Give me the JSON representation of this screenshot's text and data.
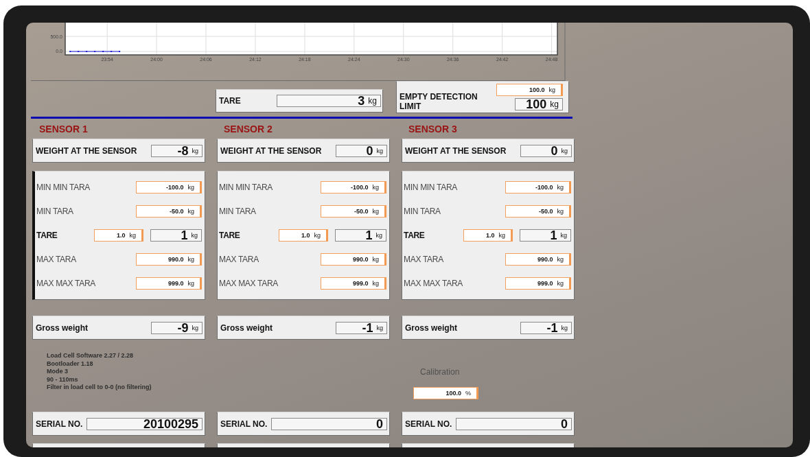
{
  "chart": {
    "chart_data": {
      "type": "line",
      "grid": true,
      "x": [
        1429.5,
        1430.5,
        1431.5,
        1432.5,
        1433.5,
        1434.5,
        1435.5
      ],
      "series": [
        {
          "color": "#1a1ad8",
          "line_style": "solid",
          "marker": "square",
          "values": [
            0,
            0,
            0,
            0,
            0,
            0,
            0
          ]
        }
      ],
      "xlim": [
        1428.9,
        1488.7
      ],
      "ylim": [
        -114,
        955
      ],
      "yticks": [
        {
          "value": 0,
          "label": "0.0"
        },
        {
          "value": 500,
          "label": "500.0"
        }
      ],
      "xticks": [
        {
          "value": 1434,
          "label": "23:54"
        },
        {
          "value": 1440,
          "label": "24:00"
        },
        {
          "value": 1446,
          "label": "24:06"
        },
        {
          "value": 1452,
          "label": "24:12"
        },
        {
          "value": 1458,
          "label": "24:18"
        },
        {
          "value": 1464,
          "label": "24:24"
        },
        {
          "value": 1470,
          "label": "24:30"
        },
        {
          "value": 1476,
          "label": "24:36"
        },
        {
          "value": 1482,
          "label": "24:42"
        },
        {
          "value": 1488,
          "label": "24:48"
        }
      ]
    }
  },
  "tare": {
    "label": "TARE",
    "value": "3",
    "unit": "kg"
  },
  "empty_detection": {
    "label": "EMPTY DETECTION LIMIT",
    "setpoint": "100.0",
    "setpoint_unit": "kg",
    "value": "100",
    "unit": "kg"
  },
  "sensors": [
    {
      "title": "SENSOR 1",
      "focused": true,
      "weight": {
        "label": "WEIGHT AT THE SENSOR",
        "value": "-8",
        "unit": "kg"
      },
      "params": [
        {
          "kind": "setpoint",
          "label": "MIN MIN TARA",
          "value": "-100.0",
          "unit": "kg"
        },
        {
          "kind": "setpoint",
          "label": "MIN TARA",
          "value": "-50.0",
          "unit": "kg"
        },
        {
          "kind": "tare",
          "label": "TARE",
          "value": "1.0",
          "unit": "kg",
          "reading": "1",
          "reading_unit": "kg"
        },
        {
          "kind": "setpoint",
          "label": "MAX TARA",
          "value": "990.0",
          "unit": "kg"
        },
        {
          "kind": "setpoint",
          "label": "MAX MAX TARA",
          "value": "999.0",
          "unit": "kg"
        }
      ],
      "gross": {
        "label": "Gross weight",
        "value": "-9",
        "unit": "kg"
      },
      "notes": [
        "Load Cell Software 2.27 / 2.28",
        "Bootloader 1.18",
        "Mode 3",
        "90 - 110ms",
        "Filter in load cell to 0-0 (no filtering)"
      ],
      "serial": {
        "label": "SERIAL NO.",
        "value": "20100295"
      }
    },
    {
      "title": "SENSOR 2",
      "focused": false,
      "weight": {
        "label": "WEIGHT AT THE SENSOR",
        "value": "0",
        "unit": "kg"
      },
      "params": [
        {
          "kind": "setpoint",
          "label": "MIN MIN TARA",
          "value": "-100.0",
          "unit": "kg"
        },
        {
          "kind": "setpoint",
          "label": "MIN TARA",
          "value": "-50.0",
          "unit": "kg"
        },
        {
          "kind": "tare",
          "label": "TARE",
          "value": "1.0",
          "unit": "kg",
          "reading": "1",
          "reading_unit": "kg"
        },
        {
          "kind": "setpoint",
          "label": "MAX TARA",
          "value": "990.0",
          "unit": "kg"
        },
        {
          "kind": "setpoint",
          "label": "MAX MAX TARA",
          "value": "999.0",
          "unit": "kg"
        }
      ],
      "gross": {
        "label": "Gross weight",
        "value": "-1",
        "unit": "kg"
      },
      "serial": {
        "label": "SERIAL NO.",
        "value": "0"
      }
    },
    {
      "title": "SENSOR 3",
      "focused": false,
      "weight": {
        "label": "WEIGHT AT THE SENSOR",
        "value": "0",
        "unit": "kg"
      },
      "params": [
        {
          "kind": "setpoint",
          "label": "MIN MIN TARA",
          "value": "-100.0",
          "unit": "kg"
        },
        {
          "kind": "setpoint",
          "label": "MIN TARA",
          "value": "-50.0",
          "unit": "kg"
        },
        {
          "kind": "tare",
          "label": "TARE",
          "value": "1.0",
          "unit": "kg",
          "reading": "1",
          "reading_unit": "kg"
        },
        {
          "kind": "setpoint",
          "label": "MAX TARA",
          "value": "990.0",
          "unit": "kg"
        },
        {
          "kind": "setpoint",
          "label": "MAX MAX TARA",
          "value": "999.0",
          "unit": "kg"
        }
      ],
      "gross": {
        "label": "Gross weight",
        "value": "-1",
        "unit": "kg"
      },
      "calibration": {
        "label": "Calibration",
        "value": "100.0",
        "unit": "%"
      },
      "serial": {
        "label": "SERIAL NO.",
        "value": "0"
      }
    }
  ]
}
